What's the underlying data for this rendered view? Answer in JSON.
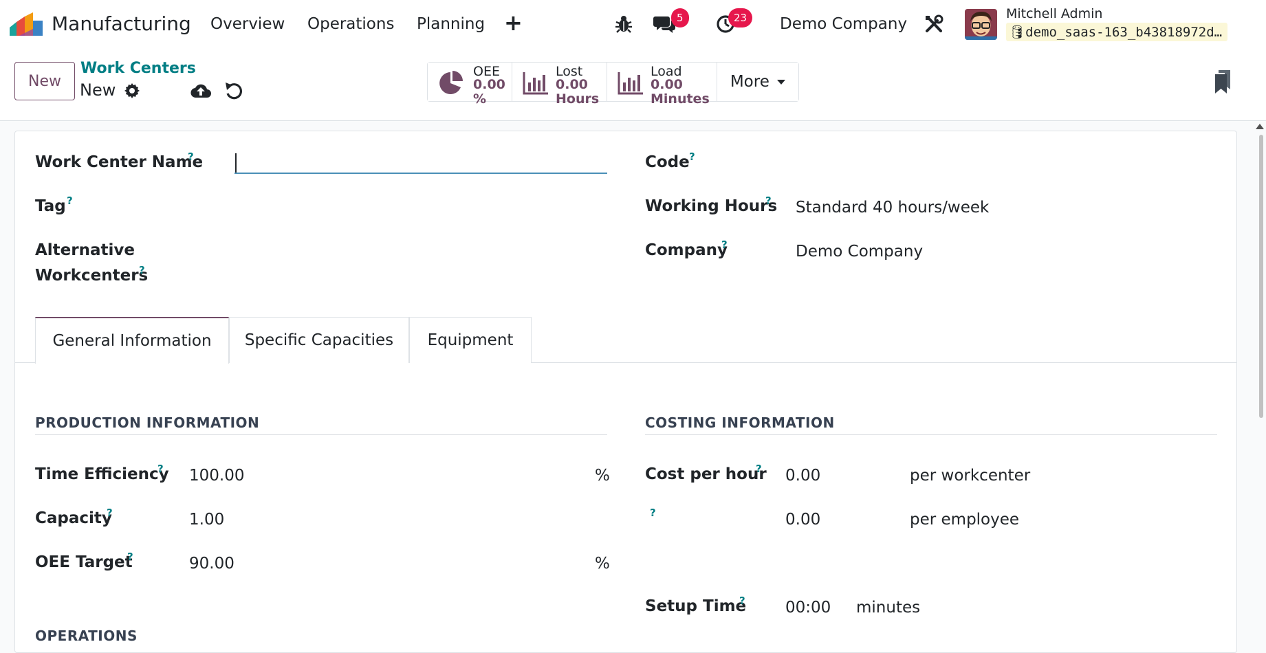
{
  "navbar": {
    "app_name": "Manufacturing",
    "menus": [
      "Overview",
      "Operations",
      "Planning"
    ],
    "plus": "+",
    "messages_count": "5",
    "activities_count": "23",
    "company": "Demo Company",
    "user_name": "Mitchell Admin",
    "db_name": "demo_saas-163_b43818972d…"
  },
  "control_panel": {
    "new_label": "New",
    "breadcrumb": "Work Centers",
    "record_name": "New",
    "stats": [
      {
        "label": "OEE",
        "value": "0.00",
        "unit": "%"
      },
      {
        "label": "Lost",
        "value": "0.00",
        "unit": "Hours"
      },
      {
        "label": "Load",
        "value": "0.00",
        "unit": "Minutes"
      }
    ],
    "more_label": "More"
  },
  "form": {
    "name_label": "Work Center Name",
    "name_value": "",
    "tag_label": "Tag",
    "alt_label_1": "Alternative",
    "alt_label_2": "Workcenters",
    "code_label": "Code",
    "hours_label": "Working Hours",
    "hours_value": "Standard 40 hours/week",
    "company_label": "Company",
    "company_value": "Demo Company",
    "help": "?"
  },
  "tabs": [
    "General Information",
    "Specific Capacities",
    "Equipment"
  ],
  "production": {
    "title": "PRODUCTION INFORMATION",
    "efficiency_label": "Time Efficiency",
    "efficiency_value": "100.00",
    "capacity_label": "Capacity",
    "capacity_value": "1.00",
    "oee_label": "OEE Target",
    "oee_value": "90.00",
    "percent": "%"
  },
  "costing": {
    "title": "COSTING INFORMATION",
    "cost_label": "Cost per hour",
    "cost_value": "0.00",
    "cost_unit": "per workcenter",
    "employee_value": "0.00",
    "employee_unit": "per employee",
    "setup_label": "Setup Time",
    "setup_value": "00:00",
    "setup_unit": "minutes"
  },
  "operations": {
    "title": "OPERATIONS"
  },
  "colors": {
    "brand": "#714b67",
    "link": "#017e84",
    "badge": "#e6174c"
  }
}
